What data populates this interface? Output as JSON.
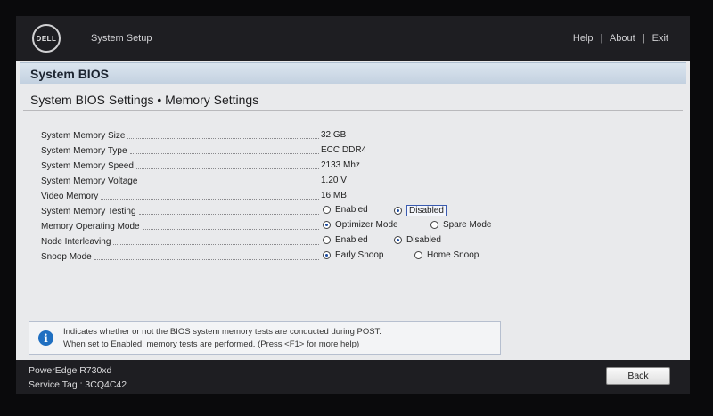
{
  "header": {
    "logo_text": "DELL",
    "app_title": "System Setup",
    "links": [
      "Help",
      "About",
      "Exit"
    ],
    "separator": "|"
  },
  "section": {
    "title": "System BIOS"
  },
  "page": {
    "title": "System BIOS Settings • Memory Settings"
  },
  "settings": {
    "system_memory_size": {
      "label": "System Memory Size",
      "value": "32 GB"
    },
    "system_memory_type": {
      "label": "System Memory Type",
      "value": "ECC DDR4"
    },
    "system_memory_speed": {
      "label": "System Memory Speed",
      "value": "2133 Mhz"
    },
    "system_memory_voltage": {
      "label": "System Memory Voltage",
      "value": "1.20 V"
    },
    "video_memory": {
      "label": "Video Memory",
      "value": "16 MB"
    },
    "system_memory_testing": {
      "label": "System Memory Testing",
      "options": [
        "Enabled",
        "Disabled"
      ],
      "selected": "Disabled"
    },
    "memory_operating_mode": {
      "label": "Memory Operating Mode",
      "options": [
        "Optimizer Mode",
        "Spare Mode"
      ],
      "selected": "Optimizer Mode"
    },
    "node_interleaving": {
      "label": "Node Interleaving",
      "options": [
        "Enabled",
        "Disabled"
      ],
      "selected": "Disabled"
    },
    "snoop_mode": {
      "label": "Snoop Mode",
      "options": [
        "Early Snoop",
        "Home Snoop"
      ],
      "selected": "Early Snoop"
    }
  },
  "help": {
    "line1": "Indicates whether or not the BIOS system memory tests are conducted during POST.",
    "line2": "When set to Enabled, memory tests are performed. (Press <F1> for more help)"
  },
  "footer": {
    "model": "PowerEdge R730xd",
    "service_tag": "Service Tag : 3CQ4C42",
    "back_label": "Back"
  },
  "colors": {
    "header_bg": "#1e1e22",
    "panel_bg": "#e9eaec",
    "section_bar": "#c3d1e0",
    "radio_selected": "#1c4ba0",
    "info_icon": "#1f6fc1"
  }
}
